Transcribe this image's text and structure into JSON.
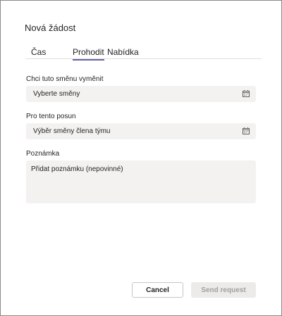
{
  "dialog": {
    "title": "Nová žádost"
  },
  "tabs": [
    {
      "label": "Čas"
    },
    {
      "label": "Prohodit",
      "active": true
    },
    {
      "label": "Nabídka"
    }
  ],
  "fields": {
    "my_shift": {
      "label": "Chci tuto směnu vyměnit",
      "value": "Vyberte směny",
      "icon": "calendar-icon"
    },
    "other_shift": {
      "label": "Pro tento posun",
      "value": "Výběr směny člena týmu",
      "icon": "calendar-icon"
    },
    "note": {
      "label": "Poznámka",
      "placeholder": "Přidat poznámku (nepovinné)"
    }
  },
  "buttons": {
    "cancel": "Cancel",
    "send": "Send request"
  },
  "colors": {
    "accent": "#6264a7",
    "field_bg": "#f3f2f1",
    "disabled_bg": "#edebe9",
    "disabled_text": "#a19f9d"
  }
}
